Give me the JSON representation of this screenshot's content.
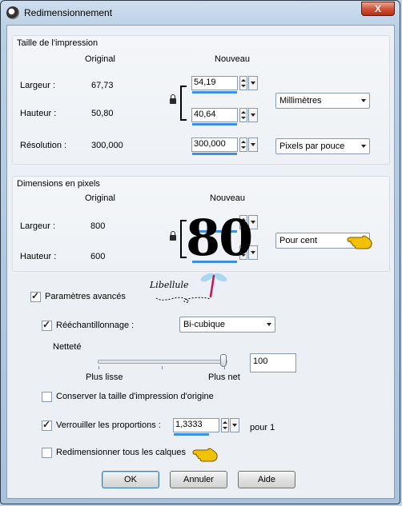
{
  "window": {
    "title": "Redimensionnement",
    "close_label": "X"
  },
  "print_size": {
    "legend": "Taille de l'impression",
    "col_original": "Original",
    "col_new": "Nouveau",
    "width_label": "Largeur :",
    "width_original": "67,73",
    "width_new": "54,19",
    "height_label": "Hauteur :",
    "height_original": "50,80",
    "height_new": "40,64",
    "unit": "Millimètres",
    "resolution_label": "Résolution :",
    "resolution_original": "300,000",
    "resolution_new": "300,000",
    "resolution_unit": "Pixels par pouce"
  },
  "pixel_dims": {
    "legend": "Dimensions en pixels",
    "col_original": "Original",
    "col_new": "Nouveau",
    "width_label": "Largeur :",
    "width_original": "800",
    "height_label": "Hauteur :",
    "height_original": "600",
    "overlay_value": "80",
    "unit": "Pour cent"
  },
  "advanced": {
    "label": "Paramètres avancés",
    "checked": true,
    "watermark": "Libellule",
    "resample_label": "Rééchantillonnage :",
    "resample_checked": true,
    "resample_method": "Bi-cubique",
    "sharpness_label": "Netteté",
    "slider_min_label": "Plus lisse",
    "slider_max_label": "Plus net",
    "sharpness_value": "100",
    "keep_print_label": "Conserver la taille d'impression d'origine",
    "keep_print_checked": false,
    "lock_ratio_label": "Verrouiller les proportions :",
    "lock_ratio_checked": true,
    "ratio_value": "1,3333",
    "ratio_suffix": "pour 1",
    "resize_layers_label": "Redimensionner tous les calques",
    "resize_layers_checked": false
  },
  "buttons": {
    "ok": "OK",
    "cancel": "Annuler",
    "help": "Aide"
  },
  "colors": {
    "accent_bar": "#3e8fe0",
    "hand": "#f2c200"
  }
}
